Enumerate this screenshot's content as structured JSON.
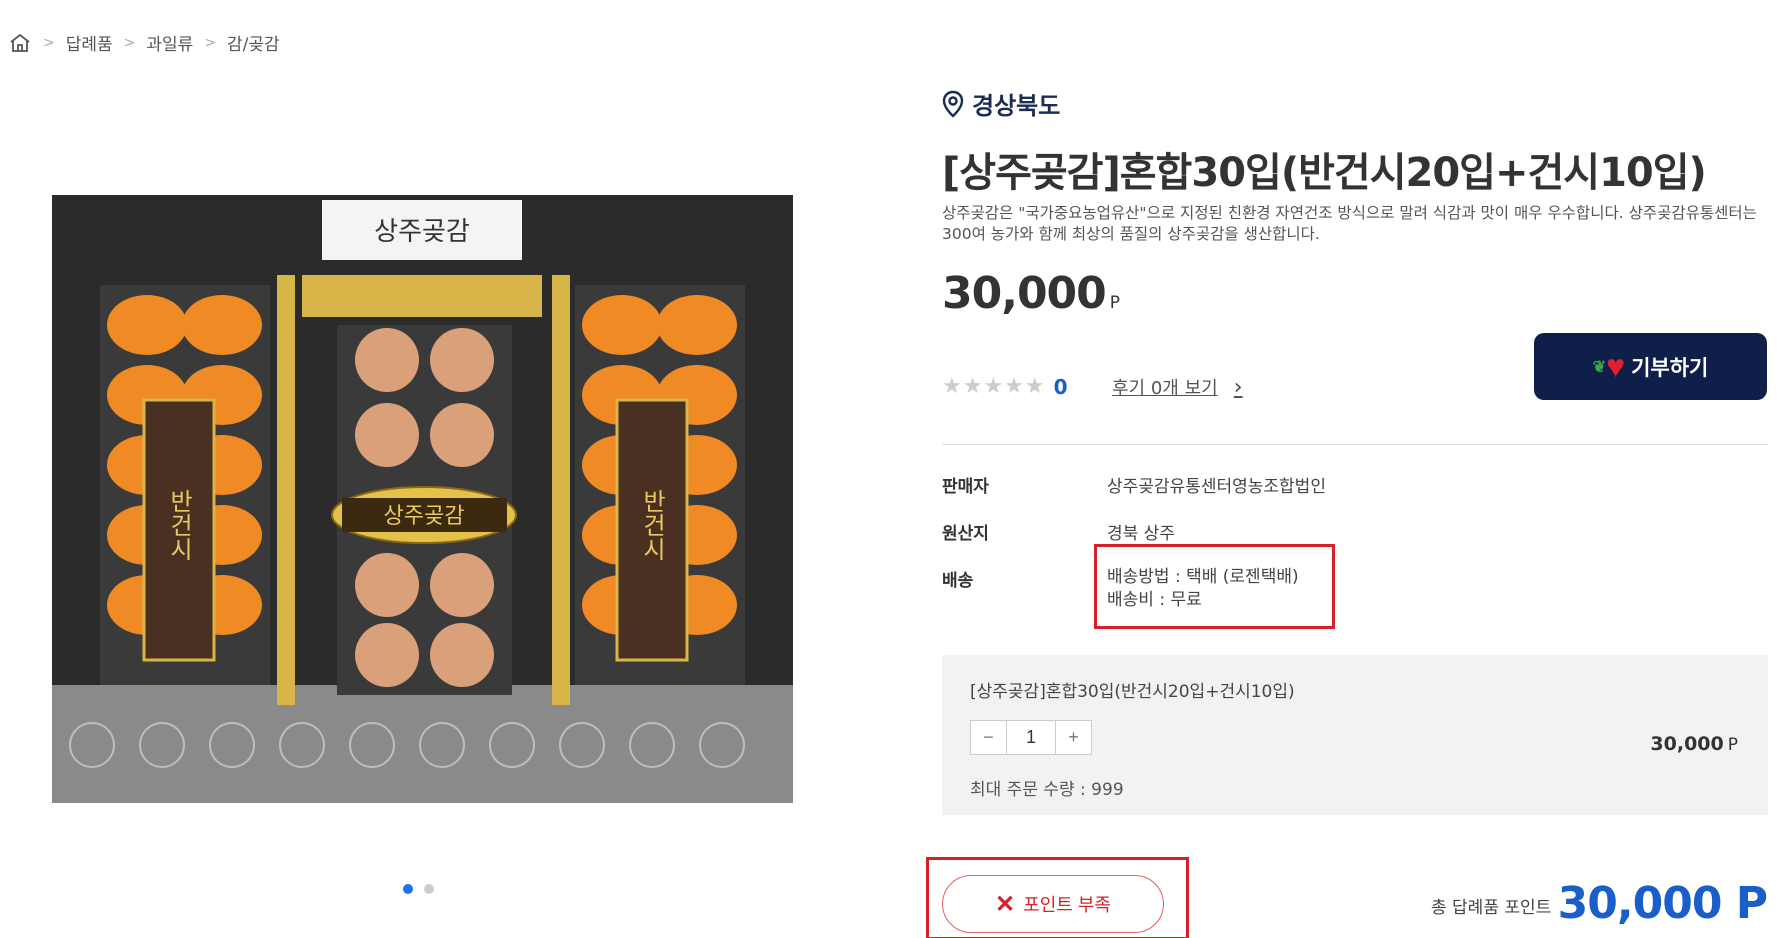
{
  "breadcrumb": {
    "items": [
      "답례품",
      "과일류",
      "감/곶감"
    ]
  },
  "gallery": {
    "label_top": "상주곶감",
    "label_center": "상주곶감",
    "label_side": "반건시",
    "pages": 2,
    "active_page": 1
  },
  "product": {
    "region": "경상북도",
    "title": "[상주곶감]혼합30입(반건시20입+건시10입)",
    "description": "상주곶감은 \"국가중요농업유산\"으로 지정된 친환경 자연건조 방식으로 말려 식감과 맛이 매우 우수합니다. 상주곶감유통센터는 300여 농가와 함께 최상의 품질의 상주곶감을 생산합니다.",
    "price": "30,000",
    "price_unit": "P",
    "rating_count": "0",
    "review_link": "후기 0개 보기",
    "donate_label": "기부하기"
  },
  "info": {
    "seller_label": "판매자",
    "seller": "상주곶감유통센터영농조합법인",
    "origin_label": "원산지",
    "origin": "경북 상주",
    "shipping_label": "배송",
    "shipping_method": "배송방법 : 택배 (로젠택배)",
    "shipping_fee": "배송비 : 무료"
  },
  "option": {
    "name": "[상주곶감]혼합30입(반건시20입+건시10입)",
    "quantity": "1",
    "minus": "−",
    "plus": "+",
    "price": "30,000",
    "price_unit": "P",
    "max_qty": "최대 주문 수량 : 999"
  },
  "footer": {
    "short_button": "포인트 부족",
    "total_label": "총 답례품 포인트",
    "total_value": "30,000 P"
  },
  "colors": {
    "brand_navy": "#0e1f4a",
    "accent_blue": "#1a5fc9",
    "alert_red": "#d8202a"
  }
}
